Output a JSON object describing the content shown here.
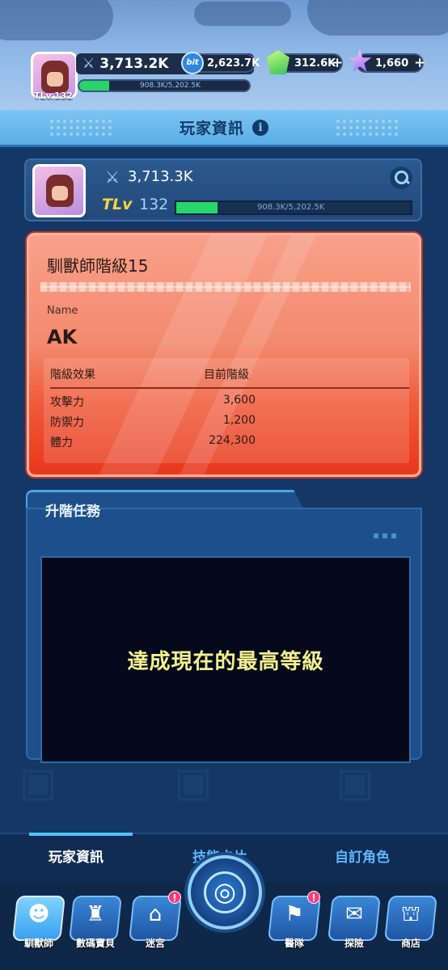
{
  "resources": {
    "avatar_level": "TLv.132",
    "power": "3,713.2K",
    "xp_text": "908.3K/5,202.5K",
    "xp_fraction": 0.175,
    "bit_icon_label": "bit",
    "bit": "2,623.7K",
    "gem": "312.6K",
    "star": "1,660"
  },
  "header": {
    "title": "玩家資訊"
  },
  "player": {
    "power": "3,713.3K",
    "tlv_label": "TLv",
    "level": "132",
    "xp_text": "908.3K/5,202.5K",
    "xp_fraction": 0.175
  },
  "rank": {
    "title": "馴獸師階級15",
    "name_label": "Name",
    "name_value": "AK",
    "col_effect": "階級效果",
    "col_current": "目前階級",
    "rows": [
      {
        "key": "攻擊力",
        "value": "3,600"
      },
      {
        "key": "防禦力",
        "value": "1,200"
      },
      {
        "key": "體力",
        "value": "224,300"
      }
    ]
  },
  "task": {
    "title": "升階任務",
    "message": "達成現在的最高等級"
  },
  "bottom_tabs": [
    "玩家資訊",
    "技能卡片",
    "自訂角色"
  ],
  "nav": {
    "items": [
      {
        "label": "馴獸師",
        "icon": "tamer-icon"
      },
      {
        "label": "數碼寶貝",
        "icon": "digimon-icon"
      },
      {
        "label": "迷宮",
        "icon": "maze-icon",
        "badge": "!"
      },
      {
        "label": "醫隊",
        "icon": "team-icon",
        "badge": "!"
      },
      {
        "label": "探險",
        "icon": "explore-icon"
      },
      {
        "label": "商店",
        "icon": "shop-icon"
      }
    ],
    "center_icon": "globe-icon"
  },
  "colors": {
    "accent": "#4fc3ff",
    "rank_card": "#ef5b3a",
    "xp_fill": "#27d76a",
    "task_message": "#f5f08e"
  }
}
